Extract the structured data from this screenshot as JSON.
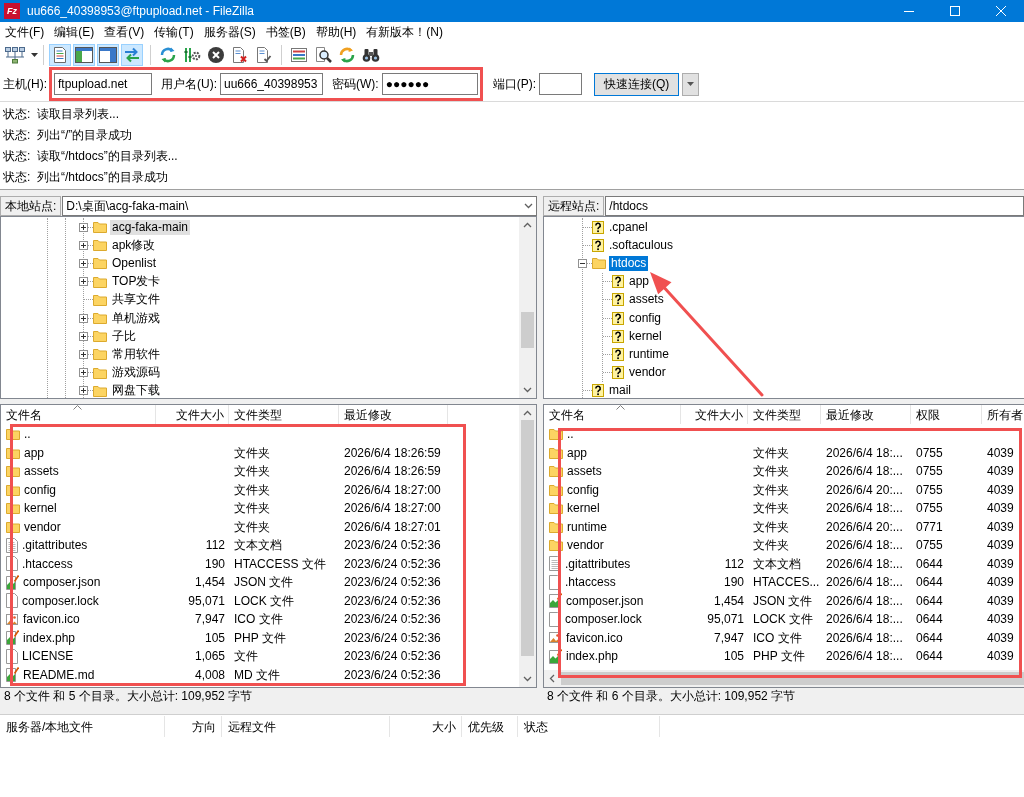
{
  "window": {
    "logo": "Fz",
    "title": "uu666_40398953@ftpupload.net - FileZilla"
  },
  "menu": [
    "文件(F)",
    "编辑(E)",
    "查看(V)",
    "传输(T)",
    "服务器(S)",
    "书签(B)",
    "帮助(H)",
    "有新版本！(N)"
  ],
  "toolbar": {
    "view_toggles": [
      {
        "on": true
      },
      {
        "on": true
      },
      {
        "on": true
      },
      {
        "on": true
      }
    ]
  },
  "quickconnect": {
    "highlighted": true,
    "host": {
      "label": "主机(H):",
      "value": "ftpupload.net"
    },
    "user": {
      "label": "用户名(U):",
      "value": "uu666_40398953"
    },
    "password": {
      "label": "密码(W):",
      "value": "●●●●●●"
    },
    "port": {
      "label": "端口(P):"
    },
    "button": "快速连接(Q)"
  },
  "log": [
    {
      "label": "状态:",
      "message": "读取目录列表..."
    },
    {
      "label": "状态:",
      "message": "列出“/”的目录成功"
    },
    {
      "label": "状态:",
      "message": "读取“/htdocs”的目录列表..."
    },
    {
      "label": "状态:",
      "message": "列出“/htdocs”的目录成功"
    }
  ],
  "local": {
    "focused": false,
    "site_label": "本地站点:",
    "path": "D:\\桌面\\acg-faka-main\\",
    "tree": [
      {
        "name": "acg-faka-main",
        "expandable": true,
        "expanded": false,
        "selected": true
      },
      {
        "name": "apk修改",
        "expandable": true,
        "expanded": false,
        "selected": false
      },
      {
        "name": "Openlist",
        "expandable": true,
        "expanded": false,
        "selected": false
      },
      {
        "name": "TOP发卡",
        "expandable": true,
        "expanded": false,
        "selected": false
      },
      {
        "name": "共享文件",
        "expandable": false,
        "selected": false
      },
      {
        "name": "单机游戏",
        "expandable": true,
        "expanded": false,
        "selected": false
      },
      {
        "name": "子比",
        "expandable": true,
        "expanded": false,
        "selected": false
      },
      {
        "name": "常用软件",
        "expandable": true,
        "expanded": false,
        "selected": false
      },
      {
        "name": "游戏源码",
        "expandable": true,
        "expanded": false,
        "selected": false
      },
      {
        "name": "网盘下载",
        "expandable": true,
        "expanded": false,
        "selected": false
      }
    ],
    "columns": [
      {
        "label": "文件名",
        "sorted": true
      },
      {
        "label": "文件大小",
        "sorted": false
      },
      {
        "label": "文件类型",
        "sorted": false
      },
      {
        "label": "最近修改",
        "sorted": false
      }
    ],
    "list_highlighted": true,
    "rows": [
      {
        "kind": "folder",
        "name": ".."
      },
      {
        "kind": "folder",
        "name": "app",
        "type": "文件夹",
        "modified": "2026/6/4 18:26:59"
      },
      {
        "kind": "folder",
        "name": "assets",
        "type": "文件夹",
        "modified": "2026/6/4 18:26:59"
      },
      {
        "kind": "folder",
        "name": "config",
        "type": "文件夹",
        "modified": "2026/6/4 18:27:00"
      },
      {
        "kind": "folder",
        "name": "kernel",
        "type": "文件夹",
        "modified": "2026/6/4 18:27:00"
      },
      {
        "kind": "folder",
        "name": "vendor",
        "type": "文件夹",
        "modified": "2026/6/4 18:27:01"
      },
      {
        "kind": "text",
        "name": ".gitattributes",
        "size": "112",
        "type": "文本文档",
        "modified": "2023/6/24 0:52:36"
      },
      {
        "kind": "file",
        "name": ".htaccess",
        "size": "190",
        "type": "HTACCESS 文件",
        "modified": "2023/6/24 0:52:36"
      },
      {
        "kind": "editable",
        "name": "composer.json",
        "size": "1,454",
        "type": "JSON 文件",
        "modified": "2023/6/24 0:52:36"
      },
      {
        "kind": "file",
        "name": "composer.lock",
        "size": "95,071",
        "type": "LOCK 文件",
        "modified": "2023/6/24 0:52:36"
      },
      {
        "kind": "image",
        "name": "favicon.ico",
        "size": "7,947",
        "type": "ICO 文件",
        "modified": "2023/6/24 0:52:36"
      },
      {
        "kind": "editable",
        "name": "index.php",
        "size": "105",
        "type": "PHP 文件",
        "modified": "2023/6/24 0:52:36"
      },
      {
        "kind": "file",
        "name": "LICENSE",
        "size": "1,065",
        "type": "文件",
        "modified": "2023/6/24 0:52:36"
      },
      {
        "kind": "editable",
        "name": "README.md",
        "size": "4,008",
        "type": "MD 文件",
        "modified": "2023/6/24 0:52:36"
      }
    ],
    "status": "8 个文件 和 5 个目录。大小总计: 109,952 字节"
  },
  "remote": {
    "focused": true,
    "site_label": "远程站点:",
    "path": "/htdocs",
    "tree": [
      {
        "name": ".cpanel",
        "listed": false,
        "expandable": false,
        "selected": false
      },
      {
        "name": ".softaculous",
        "listed": false,
        "expandable": false,
        "selected": false
      },
      {
        "name": "htdocs",
        "listed": true,
        "expandable": true,
        "expanded": true,
        "selected": true,
        "pointed": true,
        "children": [
          {
            "name": "app",
            "listed": false,
            "expandable": false,
            "selected": false
          },
          {
            "name": "assets",
            "listed": false,
            "expandable": false,
            "selected": false
          },
          {
            "name": "config",
            "listed": false,
            "expandable": false,
            "selected": false
          },
          {
            "name": "kernel",
            "listed": false,
            "expandable": false,
            "selected": false
          },
          {
            "name": "runtime",
            "listed": false,
            "expandable": false,
            "selected": false
          },
          {
            "name": "vendor",
            "listed": false,
            "expandable": false,
            "selected": false
          }
        ]
      },
      {
        "name": "mail",
        "listed": false,
        "expandable": false,
        "selected": false
      }
    ],
    "columns": [
      {
        "label": "文件名",
        "sorted": true
      },
      {
        "label": "文件大小",
        "sorted": false
      },
      {
        "label": "文件类型",
        "sorted": false
      },
      {
        "label": "最近修改",
        "sorted": false
      },
      {
        "label": "权限",
        "sorted": false
      },
      {
        "label": "所有者",
        "sorted": false
      }
    ],
    "list_highlighted": true,
    "rows": [
      {
        "kind": "folder",
        "name": ".."
      },
      {
        "kind": "folder",
        "name": "app",
        "type": "文件夹",
        "modified": "2026/6/4 18:...",
        "permissions": "0755",
        "owner": "4039"
      },
      {
        "kind": "folder",
        "name": "assets",
        "type": "文件夹",
        "modified": "2026/6/4 18:...",
        "permissions": "0755",
        "owner": "4039"
      },
      {
        "kind": "folder",
        "name": "config",
        "type": "文件夹",
        "modified": "2026/6/4 20:...",
        "permissions": "0755",
        "owner": "4039"
      },
      {
        "kind": "folder",
        "name": "kernel",
        "type": "文件夹",
        "modified": "2026/6/4 18:...",
        "permissions": "0755",
        "owner": "4039"
      },
      {
        "kind": "folder",
        "name": "runtime",
        "type": "文件夹",
        "modified": "2026/6/4 20:...",
        "permissions": "0771",
        "owner": "4039"
      },
      {
        "kind": "folder",
        "name": "vendor",
        "type": "文件夹",
        "modified": "2026/6/4 18:...",
        "permissions": "0755",
        "owner": "4039"
      },
      {
        "kind": "text",
        "name": ".gitattributes",
        "size": "112",
        "type": "文本文档",
        "modified": "2026/6/4 18:...",
        "permissions": "0644",
        "owner": "4039"
      },
      {
        "kind": "file",
        "name": ".htaccess",
        "size": "190",
        "type": "HTACCES...",
        "modified": "2026/6/4 18:...",
        "permissions": "0644",
        "owner": "4039"
      },
      {
        "kind": "editable",
        "name": "composer.json",
        "size": "1,454",
        "type": "JSON 文件",
        "modified": "2026/6/4 18:...",
        "permissions": "0644",
        "owner": "4039"
      },
      {
        "kind": "file",
        "name": "composer.lock",
        "size": "95,071",
        "type": "LOCK 文件",
        "modified": "2026/6/4 18:...",
        "permissions": "0644",
        "owner": "4039"
      },
      {
        "kind": "image",
        "name": "favicon.ico",
        "size": "7,947",
        "type": "ICO 文件",
        "modified": "2026/6/4 18:...",
        "permissions": "0644",
        "owner": "4039"
      },
      {
        "kind": "editable",
        "name": "index.php",
        "size": "105",
        "type": "PHP 文件",
        "modified": "2026/6/4 18:...",
        "permissions": "0644",
        "owner": "4039"
      }
    ],
    "status": "8 个文件 和 6 个目录。大小总计: 109,952 字节"
  },
  "queue": {
    "columns": [
      "服务器/本地文件",
      "方向",
      "远程文件",
      "大小",
      "优先级",
      "状态"
    ]
  }
}
